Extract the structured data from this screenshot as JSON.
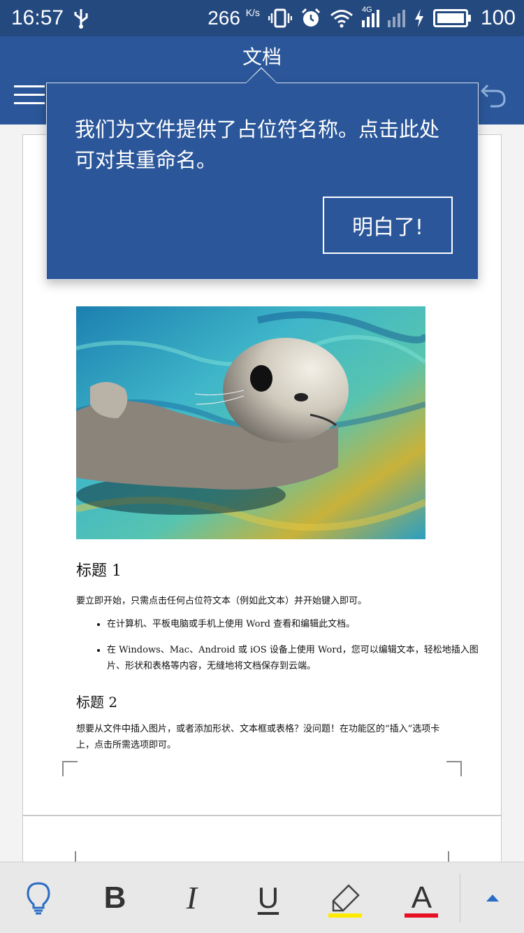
{
  "status_bar": {
    "time": "16:57",
    "speed_value": "266",
    "speed_unit": "K/s",
    "network": "4G",
    "battery": "100"
  },
  "app_bar": {
    "title": "文档"
  },
  "tooltip": {
    "message": "我们为文件提供了占位符名称。点击此处可对其重命名。",
    "button_label": "明白了!"
  },
  "document": {
    "heading1": "标题 1",
    "para1": "要立即开始，只需点击任何占位符文本（例如此文本）并开始键入即可。",
    "bullets": [
      "在计算机、平板电脑或手机上使用 Word 查看和编辑此文档。",
      "在 Windows、Mac、Android 或 iOS 设备上使用 Word，您可以编辑文本，轻松地插入图片、形状和表格等内容，无缝地将文档保存到云端。"
    ],
    "heading2": "标题 2",
    "para2": "想要从文件中插入图片，或者添加形状、文本框或表格？没问题！在功能区的“插入”选项卡上，点击所需选项即可。"
  },
  "toolbar": {
    "bold": "B",
    "italic": "I",
    "underline": "U",
    "font_color": "A",
    "highlight_color": "#ffeb00",
    "font_color_bar": "#e81123"
  },
  "colors": {
    "word_blue": "#2b579a",
    "status_blue": "#24497f"
  }
}
